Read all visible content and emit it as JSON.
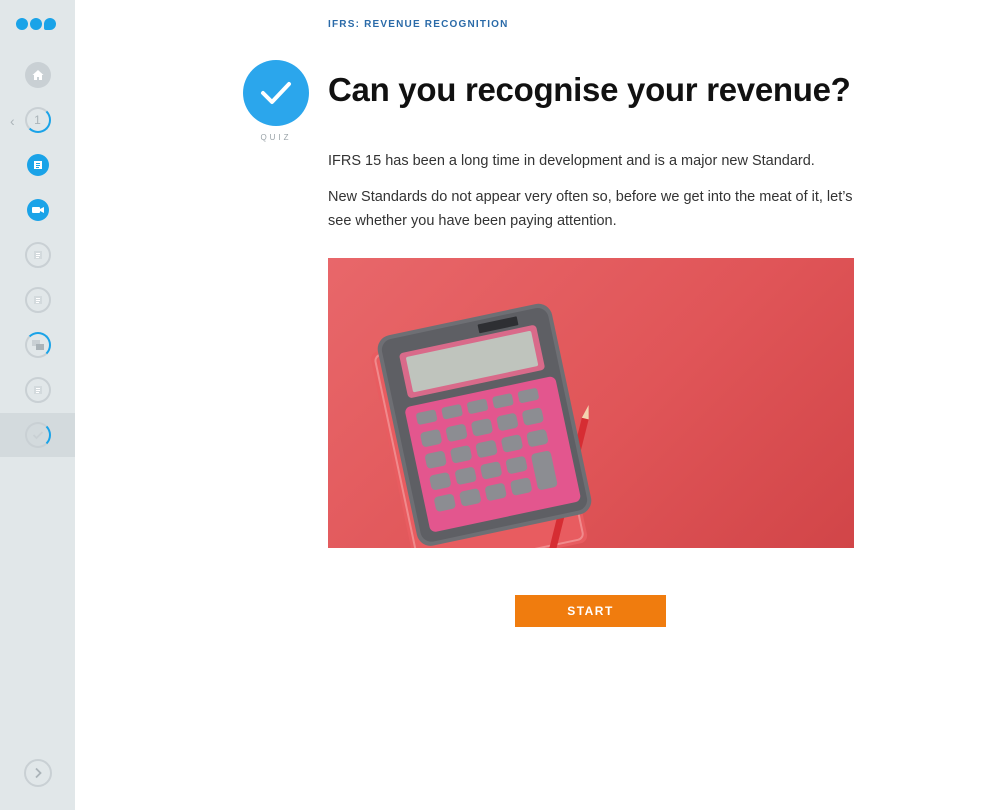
{
  "sidebar": {
    "progress_number": "1",
    "items": [
      {
        "name": "home",
        "state": "inactive"
      },
      {
        "name": "step-1",
        "state": "in-progress"
      },
      {
        "name": "article-1",
        "state": "complete"
      },
      {
        "name": "video-1",
        "state": "complete"
      },
      {
        "name": "article-2",
        "state": "not-started"
      },
      {
        "name": "article-3",
        "state": "not-started"
      },
      {
        "name": "discussion-1",
        "state": "in-progress"
      },
      {
        "name": "article-4",
        "state": "not-started"
      },
      {
        "name": "quiz-1",
        "state": "active"
      }
    ]
  },
  "breadcrumb": "IFRS: REVENUE RECOGNITION",
  "badge": {
    "label": "QUIZ",
    "icon": "checkmark-icon"
  },
  "title": "Can you recognise your revenue?",
  "paragraphs": [
    "IFRS 15 has been a long time in development and is a major new Standard.",
    "New Standards do not appear very often so, before we get into the meat of it, let’s see whether you have been paying attention."
  ],
  "start_button": "START",
  "colors": {
    "brand_blue": "#1aa3e8",
    "start_orange": "#f07c0e",
    "breadcrumb_blue": "#2a6aa8",
    "sidebar_bg": "#e1e7e9"
  }
}
